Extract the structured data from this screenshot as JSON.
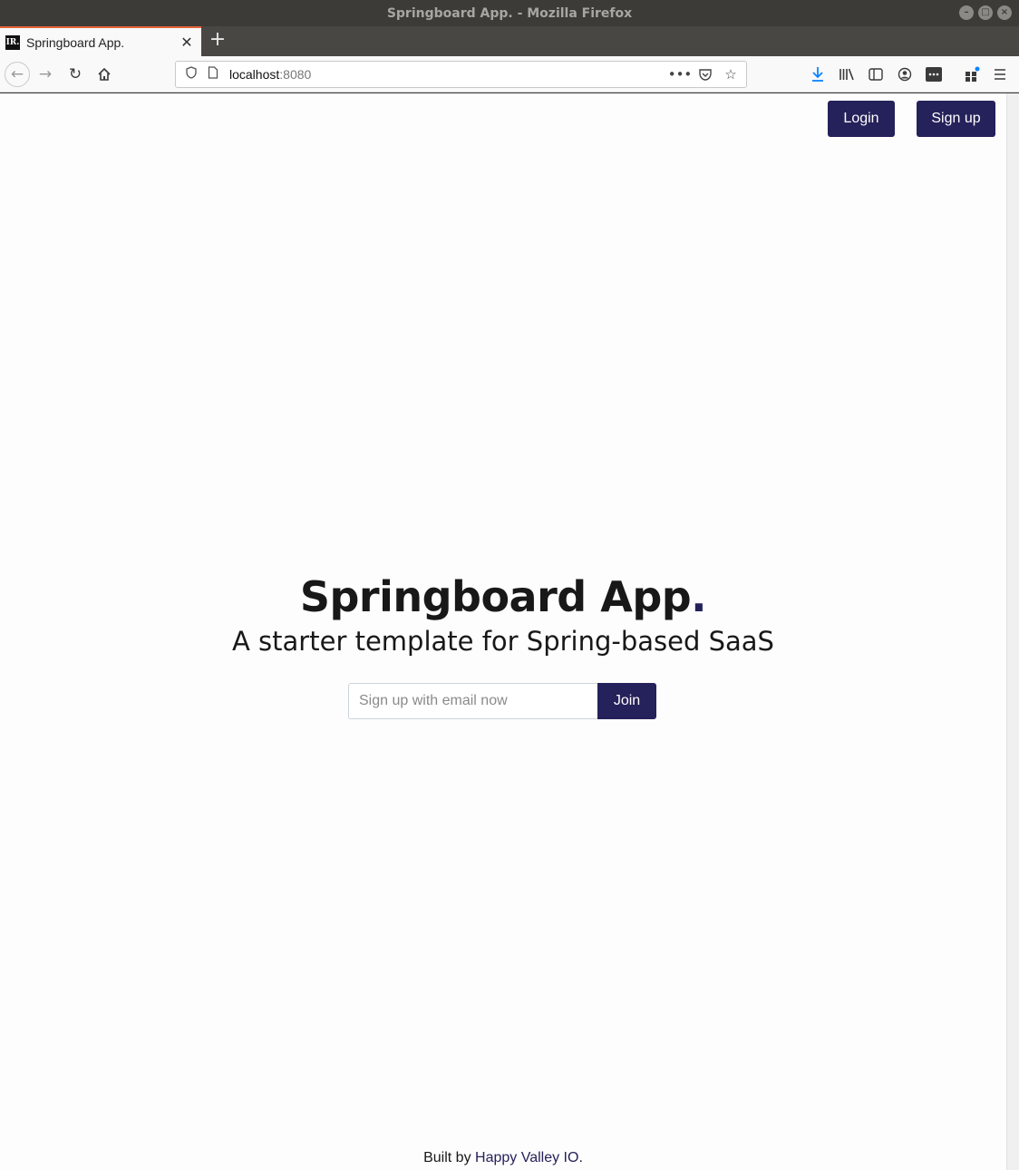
{
  "window": {
    "title": "Springboard App. - Mozilla Firefox"
  },
  "tab": {
    "favicon_text": "IR.",
    "title": "Springboard App."
  },
  "urlbar": {
    "host": "localhost",
    "port": ":8080"
  },
  "nav": {
    "login_label": "Login",
    "signup_label": "Sign up"
  },
  "hero": {
    "title": "Springboard App",
    "title_dot": ".",
    "subtitle": "A starter template for Spring-based SaaS"
  },
  "signup_form": {
    "placeholder": "Sign up with email now",
    "value": "",
    "button_label": "Join"
  },
  "footer": {
    "prefix": "Built by ",
    "link_text": "Happy Valley IO",
    "suffix": "."
  },
  "colors": {
    "brand": "#25215a",
    "tab_accent": "#e8643a",
    "background": "#fdfdfd"
  }
}
